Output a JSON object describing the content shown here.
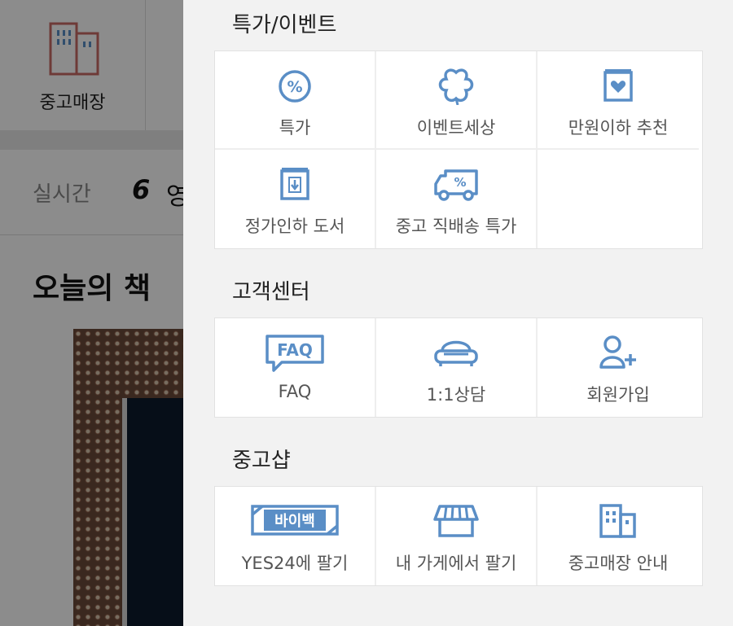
{
  "background": {
    "store_label": "중고매장",
    "realtime_label": "실시간",
    "realtime_rank": "6",
    "realtime_text": "영",
    "today_title": "오늘의 책"
  },
  "panel": {
    "sections": [
      {
        "title": "특가/이벤트",
        "items": [
          {
            "label": "특가",
            "icon": "percent-circle-icon"
          },
          {
            "label": "이벤트세상",
            "icon": "flower-icon"
          },
          {
            "label": "만원이하 추천",
            "icon": "heart-box-icon"
          },
          {
            "label": "정가인하 도서",
            "icon": "price-down-box-icon"
          },
          {
            "label": "중고 직배송 특가",
            "icon": "delivery-truck-icon"
          }
        ]
      },
      {
        "title": "고객센터",
        "items": [
          {
            "label": "FAQ",
            "icon": "faq-bubble-icon",
            "icon_text": "FAQ"
          },
          {
            "label": "1:1상담",
            "icon": "sofa-icon"
          },
          {
            "label": "회원가입",
            "icon": "person-add-icon"
          }
        ]
      },
      {
        "title": "중고샵",
        "items": [
          {
            "label": "YES24에 팔기",
            "icon": "buyback-ticket-icon",
            "icon_text": "바이백"
          },
          {
            "label": "내 가게에서 팔기",
            "icon": "shop-awning-icon"
          },
          {
            "label": "중고매장 안내",
            "icon": "building-icon"
          }
        ]
      }
    ]
  },
  "colors": {
    "icon_blue": "#5a8ec6",
    "store_icon_red": "#c96b64"
  }
}
